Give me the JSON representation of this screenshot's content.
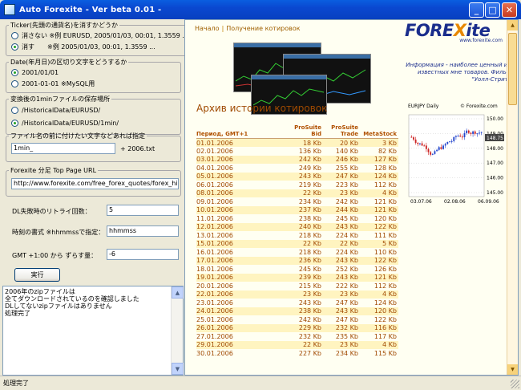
{
  "window": {
    "title": "Auto Forexite - Ver beta 0.01 -",
    "minimize": "_",
    "maximize": "□",
    "close": "✕"
  },
  "left": {
    "ticker_group": {
      "legend": "Ticker(先頭の通貨名)を消すかどうか",
      "options": [
        {
          "label": "消さない ※例 EURUSD, 2005/01/03, 00:01, 1.3559 ...",
          "selected": false
        },
        {
          "label": "消す　　※例 2005/01/03, 00:01, 1.3559 ...",
          "selected": true
        }
      ]
    },
    "date_group": {
      "legend": "Date(年月日)の区切り文字をどうするか",
      "options": [
        {
          "label": "2001/01/01",
          "selected": true
        },
        {
          "label": "2001-01-01 ※MySQL用",
          "selected": false
        }
      ]
    },
    "path_group": {
      "legend": "変換後の1minファイルの保存場所",
      "options": [
        {
          "label": "/HistoricalData/EURUSD/",
          "selected": false
        },
        {
          "label": "/HistoricalData/EURUSD/1min/",
          "selected": true
        }
      ]
    },
    "prefix_group": {
      "legend": "ファイル名の前に付けたい文字などあれば指定",
      "value": "1min_",
      "suffix": "+ 2006.txt"
    },
    "url_group": {
      "legend": "Forexite 分足 Top Page URL",
      "value": "http://www.forexite.com/free_forex_quotes/forex_history_arhiv.htm"
    },
    "retry": {
      "label": "DL失敗時のリトライ回数：",
      "value": "5"
    },
    "time_format": {
      "label": "時刻の書式 ※hhmmssで指定：",
      "value": "hhmmss"
    },
    "gmt_shift": {
      "label": "GMT +1:00 から ずらす量：",
      "value": "-6"
    },
    "run_button": "実行",
    "log": "2006年のzipファイルは\n全てダウンロードされているのを確認しました\nDLしてないzipファイルはありません\n処理完了"
  },
  "browser": {
    "breadcrumb": [
      "Начало",
      "Получение котировок"
    ],
    "breadcrumb_sep": "|",
    "logo_text": "FOREXite",
    "logo_url": "www.forexite.com",
    "tagline": "Информация - наиболее ценный из известных мне товаров. Фильм \"Уолл-Стрит\"",
    "page_title": "Архив истории котировок",
    "table": {
      "headers": [
        "Период, GMT+1",
        "ProSuite Bid",
        "ProSuite Trade",
        "MetaStock"
      ],
      "rows": [
        [
          "01.01.2006",
          "18 Kb",
          "20 Kb",
          "3 Kb"
        ],
        [
          "02.01.2006",
          "136 Kb",
          "140 Kb",
          "82 Kb"
        ],
        [
          "03.01.2006",
          "242 Kb",
          "246 Kb",
          "127 Kb"
        ],
        [
          "04.01.2006",
          "249 Kb",
          "255 Kb",
          "128 Kb"
        ],
        [
          "05.01.2006",
          "243 Kb",
          "247 Kb",
          "124 Kb"
        ],
        [
          "06.01.2006",
          "219 Kb",
          "223 Kb",
          "112 Kb"
        ],
        [
          "08.01.2006",
          "22 Kb",
          "23 Kb",
          "4 Kb"
        ],
        [
          "09.01.2006",
          "234 Kb",
          "242 Kb",
          "121 Kb"
        ],
        [
          "10.01.2006",
          "237 Kb",
          "244 Kb",
          "121 Kb"
        ],
        [
          "11.01.2006",
          "238 Kb",
          "245 Kb",
          "120 Kb"
        ],
        [
          "12.01.2006",
          "240 Kb",
          "243 Kb",
          "122 Kb"
        ],
        [
          "13.01.2006",
          "218 Kb",
          "224 Kb",
          "111 Kb"
        ],
        [
          "15.01.2006",
          "22 Kb",
          "22 Kb",
          "5 Kb"
        ],
        [
          "16.01.2006",
          "218 Kb",
          "224 Kb",
          "110 Kb"
        ],
        [
          "17.01.2006",
          "236 Kb",
          "243 Kb",
          "122 Kb"
        ],
        [
          "18.01.2006",
          "245 Kb",
          "252 Kb",
          "126 Kb"
        ],
        [
          "19.01.2006",
          "239 Kb",
          "243 Kb",
          "121 Kb"
        ],
        [
          "20.01.2006",
          "215 Kb",
          "222 Kb",
          "112 Kb"
        ],
        [
          "22.01.2006",
          "23 Kb",
          "23 Kb",
          "4 Kb"
        ],
        [
          "23.01.2006",
          "243 Kb",
          "247 Kb",
          "124 Kb"
        ],
        [
          "24.01.2006",
          "238 Kb",
          "243 Kb",
          "120 Kb"
        ],
        [
          "25.01.2006",
          "242 Kb",
          "247 Kb",
          "122 Kb"
        ],
        [
          "26.01.2006",
          "229 Kb",
          "232 Kb",
          "116 Kb"
        ],
        [
          "27.01.2006",
          "232 Kb",
          "235 Kb",
          "117 Kb"
        ],
        [
          "29.01.2006",
          "22 Kb",
          "23 Kb",
          "4 Kb"
        ],
        [
          "30.01.2006",
          "227 Kb",
          "234 Kb",
          "115 Kb"
        ]
      ]
    },
    "mini_chart": {
      "title": "EURJPY Daily",
      "brand": "© Forexite.com",
      "y_ticks": [
        "150.00",
        "149.00",
        "148.00",
        "147.00",
        "146.00",
        "145.00"
      ],
      "current_price": "148.75",
      "x_ticks": [
        "03.07.06",
        "02.08.06",
        "06.09.06"
      ],
      "up_color": "#2244cc",
      "down_color": "#cc2222"
    }
  },
  "status": "処理完了"
}
